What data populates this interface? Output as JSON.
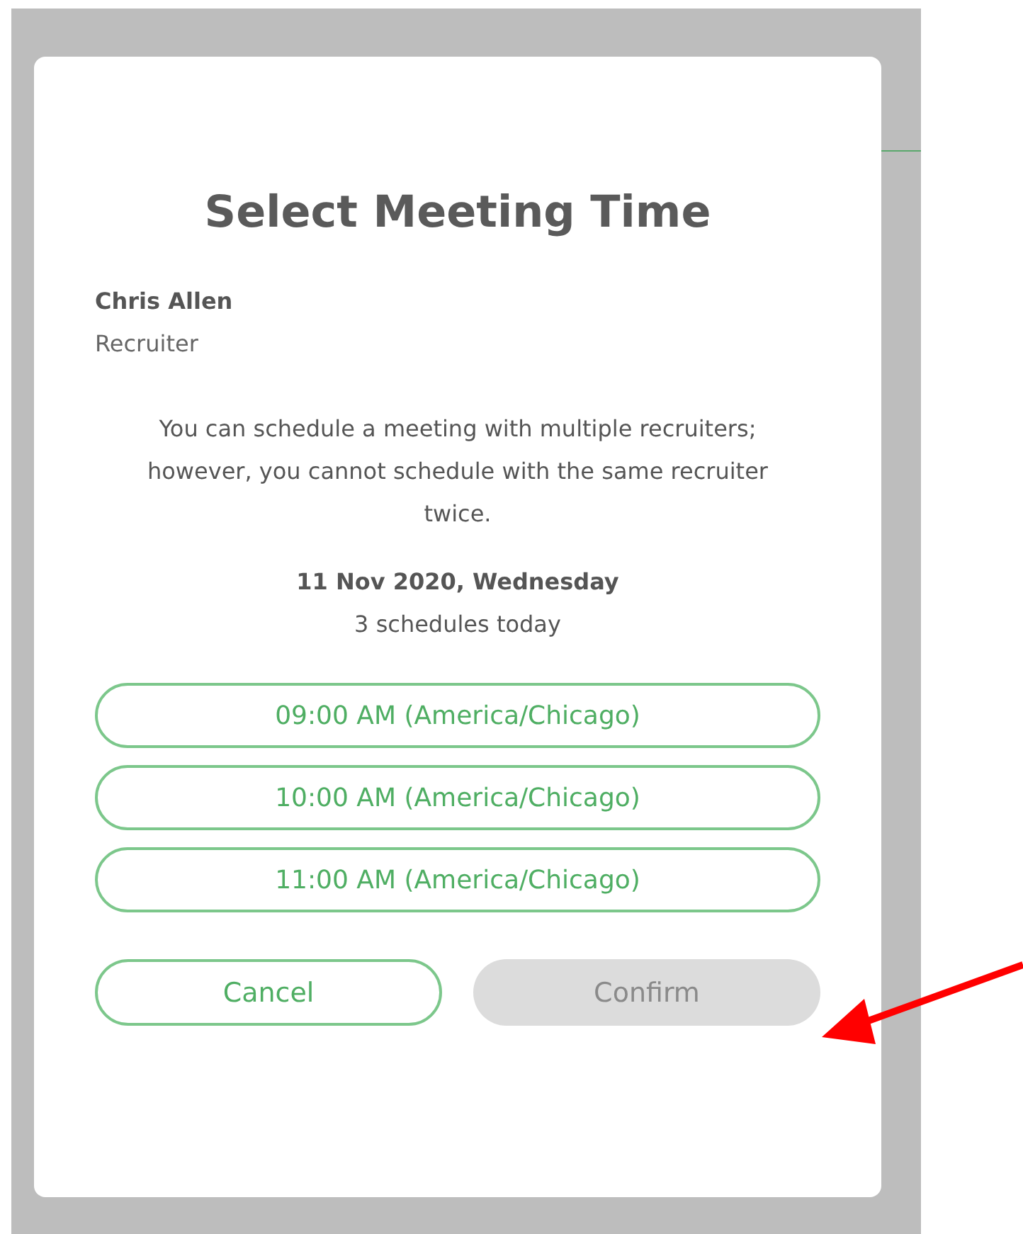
{
  "dialog": {
    "title": "Select Meeting Time",
    "recruiter": {
      "name": "Chris Allen",
      "role": "Recruiter"
    },
    "notice": "You can schedule a meeting with multiple recruiters; however, you cannot schedule with the same recruiter twice.",
    "date": "11 Nov 2020, Wednesday",
    "count": "3 schedules today",
    "slots": [
      {
        "label": "09:00 AM (America/Chicago)",
        "selected": false
      },
      {
        "label": "10:00 AM (America/Chicago)",
        "selected": false
      },
      {
        "label": "11:00 AM (America/Chicago)",
        "selected": false
      }
    ],
    "buttons": [
      {
        "label": "Cancel",
        "kind": "outline",
        "disabled": false
      },
      {
        "label": "Confirm",
        "kind": "filled",
        "disabled": true
      }
    ]
  }
}
